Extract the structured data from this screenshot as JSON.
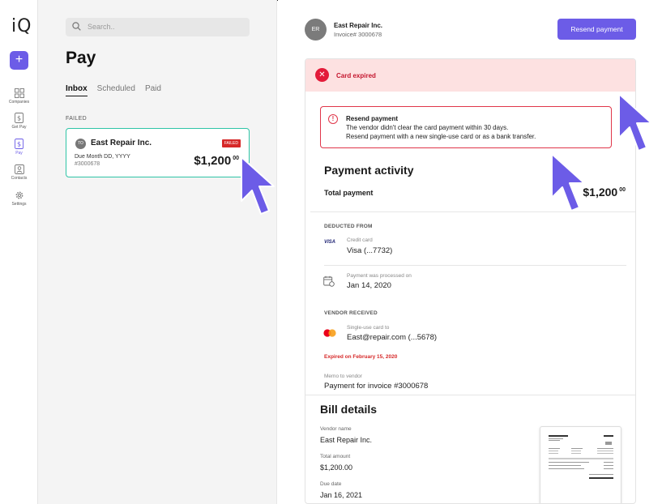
{
  "rail": {
    "logo": "iQ",
    "items": [
      {
        "label": "Companies",
        "icon": "grid-icon"
      },
      {
        "label": "Get Pay",
        "icon": "dollar-doc-icon"
      },
      {
        "label": "Pay",
        "icon": "dollar-doc-icon"
      },
      {
        "label": "Contacts",
        "icon": "contact-card-icon"
      },
      {
        "label": "Settings",
        "icon": "gear-icon"
      }
    ],
    "accent": "#6c5ce7"
  },
  "middle": {
    "search_placeholder": "Search..",
    "title": "Pay",
    "tabs": [
      "Inbox",
      "Scheduled",
      "Paid"
    ],
    "section": "FAILED",
    "card": {
      "initials": "TO",
      "name": "East Repair Inc.",
      "badge": "FAILED",
      "due": "Due Month DD, YYYY",
      "invoice": "#3000678",
      "amount": "$1,200",
      "amount_cents": "00"
    }
  },
  "detail": {
    "vendor_initials": "ER",
    "vendor_name": "East Repair Inc.",
    "invoice": "Invoice# 3000678",
    "resend_button": "Resend payment",
    "banner": "Card expired",
    "warning": {
      "title": "Resend payment",
      "line1": "The vendor didn't clear the card payment within 30 days.",
      "line2": "Resend payment with a new single-use card or as a bank transfer."
    },
    "activity_title": "Payment activity",
    "total_label": "Total payment",
    "total_amount": "$1,200",
    "total_cents": "00",
    "deducted_from": "DEDUCTED FROM",
    "card_brand": "VISA",
    "credit_card_label": "Credit card",
    "credit_card_value": "Visa (...7732)",
    "processed_label": "Payment was processed on",
    "processed_value": "Jan 14, 2020",
    "vendor_received": "VENDOR RECEIVED",
    "single_use_label": "Single-use card to",
    "single_use_value": "East@repair.com (...5678)",
    "expired_note": "Expired on February 15, 2020",
    "memo_label": "Memo to vendor",
    "memo_value": "Payment for invoice #3000678",
    "bill_title": "Bill details",
    "vendor_name_label": "Vendor name",
    "vendor_name_value": "East Repair Inc.",
    "total_amount_label": "Total amount",
    "total_amount_value": "$1,200.00",
    "due_date_label": "Due date",
    "due_date_value": "Jan 16, 2021"
  }
}
